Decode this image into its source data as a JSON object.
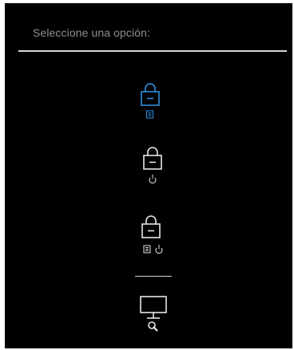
{
  "menu": {
    "prompt": "Seleccione una opción:"
  },
  "options": [
    {
      "id": "lock-menu",
      "icon": "lock-icon",
      "badges": [
        "menu-button-icon"
      ],
      "selected": true
    },
    {
      "id": "lock-power",
      "icon": "lock-icon",
      "badges": [
        "power-button-icon"
      ],
      "selected": false
    },
    {
      "id": "lock-menu-power",
      "icon": "lock-icon",
      "badges": [
        "menu-button-icon",
        "power-button-icon"
      ],
      "selected": false
    },
    {
      "id": "self-diagnostics",
      "icon": "monitor-icon",
      "badges": [
        "diagnostic-wrench-icon"
      ],
      "selected": false
    }
  ],
  "colors": {
    "background": "#000000",
    "text_muted": "#8f8f8f",
    "icon": "#e6e6e6",
    "selected_accent": "#2f8fe0",
    "divider": "#d6d6d6"
  }
}
